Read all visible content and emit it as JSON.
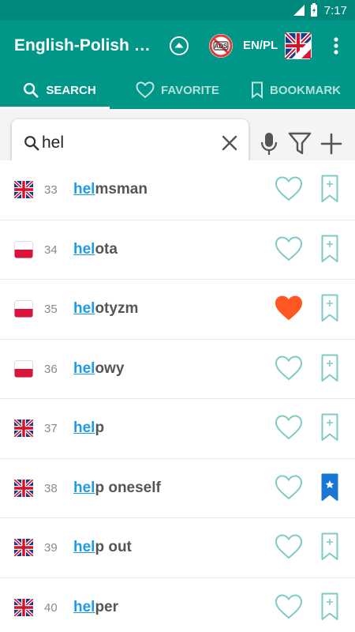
{
  "status_bar": {
    "time": "7:17"
  },
  "app_bar": {
    "title": "English-Polish d…",
    "lang_label": "EN/PL",
    "ads_text": "ADS"
  },
  "tabs": [
    {
      "label": "SEARCH",
      "icon": "search-icon",
      "active": true
    },
    {
      "label": "FAVORITE",
      "icon": "heart-icon",
      "active": false
    },
    {
      "label": "BOOKMARK",
      "icon": "bookmark-icon",
      "active": false
    }
  ],
  "search": {
    "value": "hel",
    "placeholder": ""
  },
  "colors": {
    "primary": "#009688",
    "status_bar": "#00897b",
    "highlight": "#1e9be8",
    "heart_filled": "#ff5722",
    "bookmark_filled": "#1976d2",
    "outline": "#7fcbc4"
  },
  "words": [
    {
      "num": "33",
      "prefix": "hel",
      "rest": "msman",
      "lang": "en",
      "favorite": false,
      "bookmarked": false
    },
    {
      "num": "34",
      "prefix": "hel",
      "rest": "ota",
      "lang": "pl",
      "favorite": false,
      "bookmarked": false
    },
    {
      "num": "35",
      "prefix": "hel",
      "rest": "otyzm",
      "lang": "pl",
      "favorite": true,
      "bookmarked": false
    },
    {
      "num": "36",
      "prefix": "hel",
      "rest": "owy",
      "lang": "pl",
      "favorite": false,
      "bookmarked": false
    },
    {
      "num": "37",
      "prefix": "hel",
      "rest": "p",
      "lang": "en",
      "favorite": false,
      "bookmarked": false
    },
    {
      "num": "38",
      "prefix": "hel",
      "rest": "p oneself",
      "lang": "en",
      "favorite": false,
      "bookmarked": true
    },
    {
      "num": "39",
      "prefix": "hel",
      "rest": "p out",
      "lang": "en",
      "favorite": false,
      "bookmarked": false
    },
    {
      "num": "40",
      "prefix": "hel",
      "rest": "per",
      "lang": "en",
      "favorite": false,
      "bookmarked": false
    }
  ]
}
